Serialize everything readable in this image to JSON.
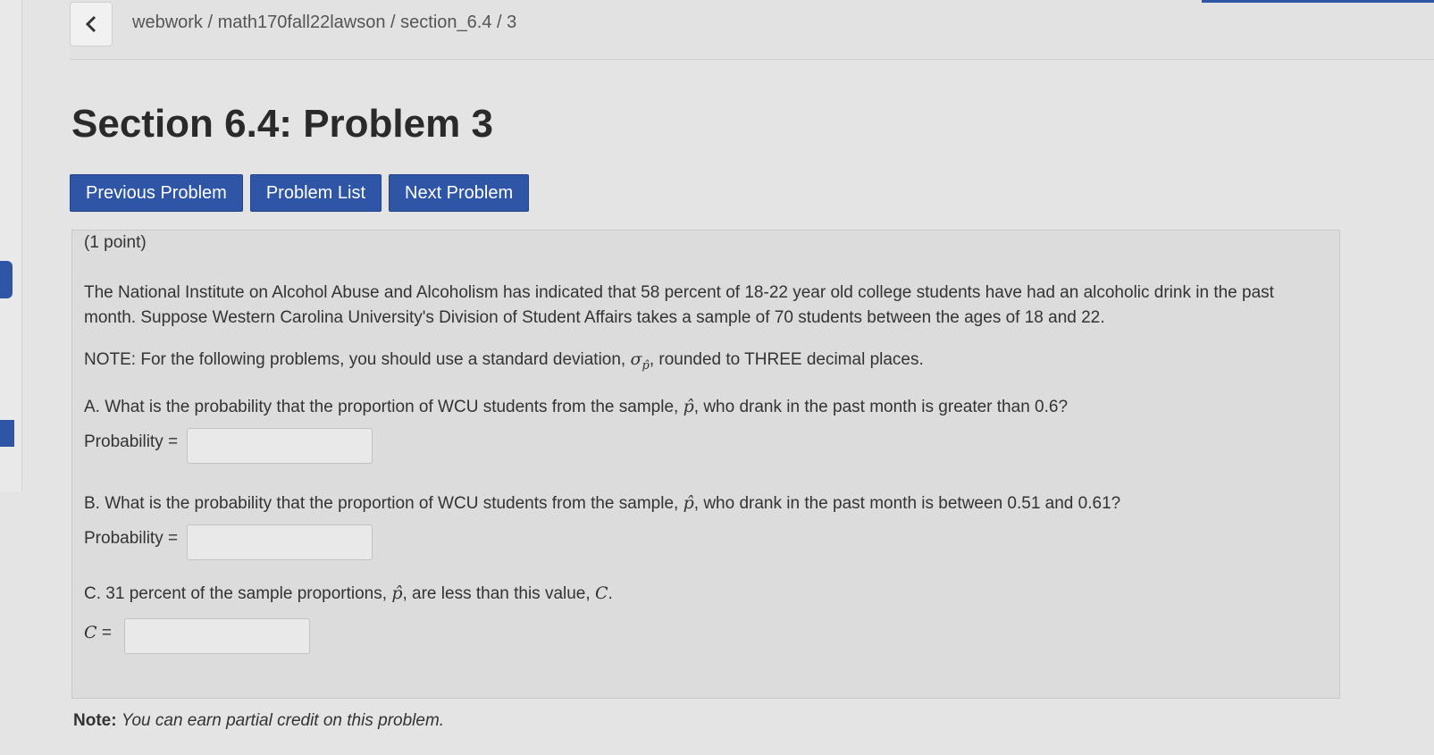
{
  "nav": {
    "back_icon": "chevron-left-icon",
    "breadcrumb": "webwork / math170fall22lawson / section_6.4 / 3"
  },
  "page": {
    "title": "Section 6.4: Problem 3"
  },
  "buttons": {
    "previous": "Previous Problem",
    "list": "Problem List",
    "next": "Next Problem"
  },
  "problem": {
    "points": "(1 point)",
    "intro_line1": "The National Institute on Alcohol Abuse and Alcoholism has indicated that 58 percent of 18-22 year old college students have had an alcoholic drink in the past",
    "intro_line2": "month. Suppose Western Carolina University's Division of Student Affairs takes a sample of 70 students between the ages of 18 and 22.",
    "note_prefix": "NOTE: For the following problems, you should use a standard deviation, ",
    "sigma_symbol": "σ",
    "phat_symbol": "p̂",
    "note_suffix": ", rounded to THREE decimal places.",
    "qa_prefix": "A. What is the probability that the proportion of WCU students from the sample, ",
    "qa_suffix": ", who drank in the past month is greater than 0.6?",
    "qa_label": "Probability =",
    "qb_prefix": "B. What is the probability that the proportion of WCU students from the sample, ",
    "qb_suffix": ", who drank in the past month is between 0.51 and 0.61?",
    "qb_label": "Probability =",
    "qc_prefix": "C. 31 percent of the sample proportions, ",
    "qc_mid": ", are less than this value, ",
    "qc_var": "C",
    "qc_end": ".",
    "qc_label_var": "C",
    "qc_label_eq": " ="
  },
  "footer": {
    "note_label": "Note:",
    "note_text": "You can earn partial credit on this problem."
  },
  "colors": {
    "accent": "#2f56a6",
    "background": "#e4e4e4",
    "panel": "#dcdcdc"
  }
}
